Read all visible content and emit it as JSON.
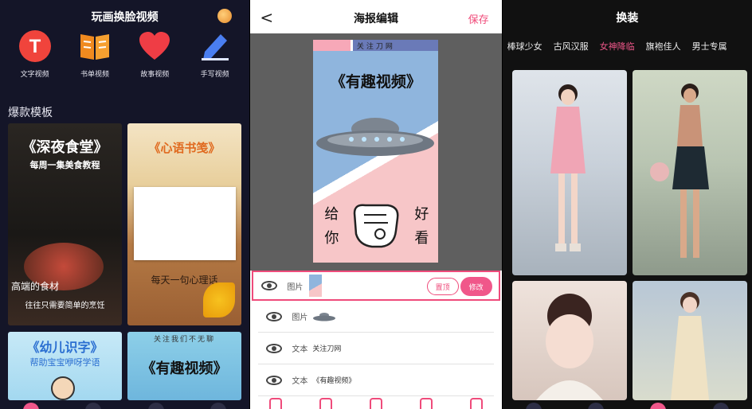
{
  "panel1": {
    "title": "玩画换脸视频",
    "shortcuts": [
      {
        "label": "文字视频",
        "icon": "text-t-icon",
        "color": "#f0443c"
      },
      {
        "label": "书单视频",
        "icon": "book-icon",
        "color": "#f08a1f"
      },
      {
        "label": "故事视频",
        "icon": "heart-icon",
        "color": "#ef3d45"
      },
      {
        "label": "手写视频",
        "icon": "pen-icon",
        "color": "#4a7ef0"
      }
    ],
    "section_title": "爆款模板",
    "templates": [
      {
        "title": "《深夜食堂》",
        "subtitle": "每周一集美食教程",
        "bottom1": "高端的食材",
        "bottom2": "往往只需要简单的烹饪"
      },
      {
        "title": "《心语书笺》",
        "bottom": "每天一句心理话"
      },
      {
        "title": "《幼儿识字》",
        "subtitle": "帮助宝宝咿呀学语"
      },
      {
        "top": "关注我们不无聊",
        "title": "《有趣视频》"
      }
    ]
  },
  "panel2": {
    "title": "海报编辑",
    "back": "<",
    "save": "保存",
    "poster": {
      "top_text": "关注刀网",
      "title": "《有趣视频》",
      "left_chars": "给你",
      "right_chars": "好看"
    },
    "layers": [
      {
        "type": "图片",
        "value": "",
        "selected": true,
        "buttons": [
          "置顶",
          "修改"
        ]
      },
      {
        "type": "图片",
        "value": ""
      },
      {
        "type": "文本",
        "value": "关注刀网"
      },
      {
        "type": "文本",
        "value": "《有趣视频》"
      }
    ]
  },
  "panel3": {
    "title": "换装",
    "tabs": [
      "棒球少女",
      "古风汉服",
      "女神降临",
      "旗袍佳人",
      "男士专属"
    ],
    "active_tab": "女神降临"
  },
  "colors": {
    "accent": "#f0578a",
    "panel1_bg": "#141528"
  }
}
